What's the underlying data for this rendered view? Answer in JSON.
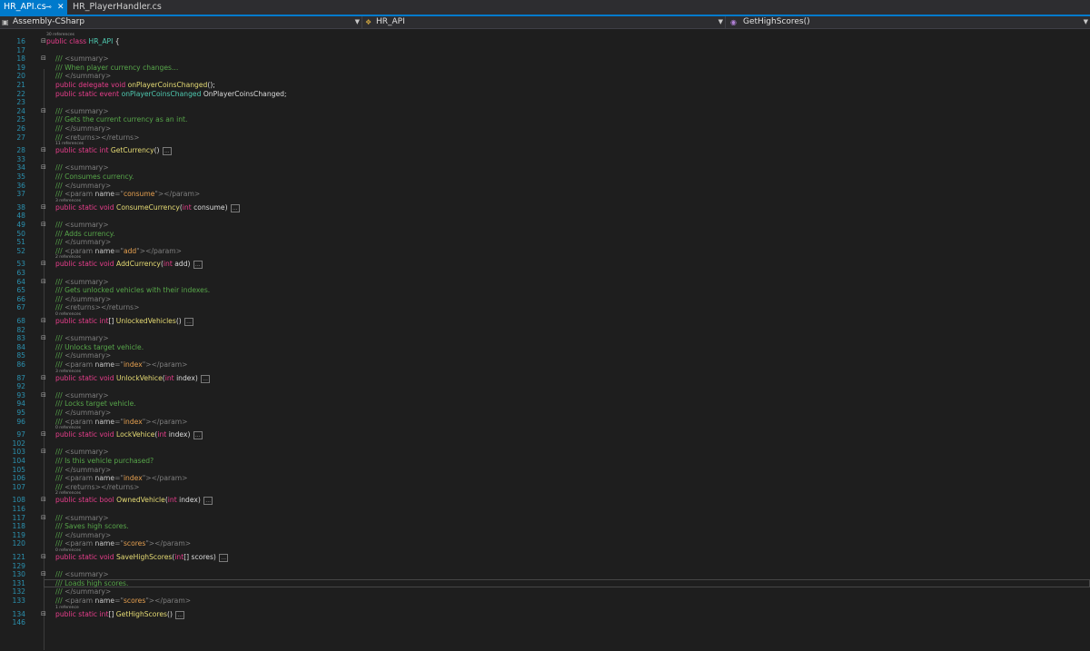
{
  "tabs": [
    {
      "label": "HR_API.cs",
      "active": true
    },
    {
      "label": "HR_PlayerHandler.cs",
      "active": false
    }
  ],
  "navigation": {
    "project": "Assembly-CSharp",
    "type": "HR_API",
    "member": "GetHighScores()"
  },
  "colors": {
    "accent": "#007acc",
    "background": "#1e1e1e",
    "keyword": "#e83e8c",
    "type": "#4ec9b0",
    "comment": "#57a64a",
    "line_number": "#2b91af"
  },
  "lines": [
    {
      "kind": "lens",
      "text": "30 references"
    },
    {
      "n": "16",
      "fold": true,
      "indent": 0,
      "tokens": [
        [
          "kw",
          "public class "
        ],
        [
          "cls",
          "HR_API"
        ],
        [
          "pl",
          " {"
        ]
      ]
    },
    {
      "n": "17",
      "indent": 1,
      "tokens": []
    },
    {
      "n": "18",
      "fold": true,
      "indent": 1,
      "tokens": [
        [
          "cm",
          "/// "
        ],
        [
          "xml",
          "<summary>"
        ]
      ]
    },
    {
      "n": "19",
      "indent": 1,
      "tokens": [
        [
          "cm",
          "/// When player currency changes..."
        ]
      ]
    },
    {
      "n": "20",
      "indent": 1,
      "tokens": [
        [
          "cm",
          "/// "
        ],
        [
          "xml",
          "</summary>"
        ]
      ]
    },
    {
      "n": "21",
      "indent": 1,
      "tokens": [
        [
          "kw",
          "public delegate void "
        ],
        [
          "fn",
          "onPlayerCoinsChanged"
        ],
        [
          "pl",
          "();"
        ]
      ]
    },
    {
      "n": "22",
      "indent": 1,
      "tokens": [
        [
          "kw",
          "public static event "
        ],
        [
          "cls",
          "onPlayerCoinsChanged "
        ],
        [
          "pl",
          "OnPlayerCoinsChanged;"
        ]
      ]
    },
    {
      "n": "23",
      "indent": 1,
      "tokens": []
    },
    {
      "n": "24",
      "fold": true,
      "indent": 1,
      "tokens": [
        [
          "cm",
          "/// "
        ],
        [
          "xml",
          "<summary>"
        ]
      ]
    },
    {
      "n": "25",
      "indent": 1,
      "tokens": [
        [
          "cm",
          "/// Gets the current currency as an int."
        ]
      ]
    },
    {
      "n": "26",
      "indent": 1,
      "tokens": [
        [
          "cm",
          "/// "
        ],
        [
          "xml",
          "</summary>"
        ]
      ]
    },
    {
      "n": "27",
      "indent": 1,
      "tokens": [
        [
          "cm",
          "/// "
        ],
        [
          "xml",
          "<returns></returns>"
        ]
      ]
    },
    {
      "kind": "lens",
      "indent": 1,
      "text": "11 references"
    },
    {
      "n": "28",
      "fold": true,
      "indent": 1,
      "tokens": [
        [
          "kw",
          "public static int "
        ],
        [
          "fn",
          "GetCurrency"
        ],
        [
          "pl",
          "() "
        ]
      ],
      "collapsed": "..."
    },
    {
      "n": "33",
      "indent": 1,
      "tokens": []
    },
    {
      "n": "34",
      "fold": true,
      "indent": 1,
      "tokens": [
        [
          "cm",
          "/// "
        ],
        [
          "xml",
          "<summary>"
        ]
      ]
    },
    {
      "n": "35",
      "indent": 1,
      "tokens": [
        [
          "cm",
          "/// Consumes currency."
        ]
      ]
    },
    {
      "n": "36",
      "indent": 1,
      "tokens": [
        [
          "cm",
          "/// "
        ],
        [
          "xml",
          "</summary>"
        ]
      ]
    },
    {
      "n": "37",
      "indent": 1,
      "tokens": [
        [
          "cm",
          "/// "
        ],
        [
          "xml",
          "<param "
        ],
        [
          "attr",
          "name"
        ],
        [
          "xml",
          "=\""
        ],
        [
          "str",
          "consume"
        ],
        [
          "xml",
          "\"></param>"
        ]
      ]
    },
    {
      "kind": "lens",
      "indent": 1,
      "text": "3 references"
    },
    {
      "n": "38",
      "fold": true,
      "indent": 1,
      "tokens": [
        [
          "kw",
          "public static void "
        ],
        [
          "fn",
          "ConsumeCurrency"
        ],
        [
          "pl",
          "("
        ],
        [
          "kw",
          "int "
        ],
        [
          "pl",
          "consume) "
        ]
      ],
      "collapsed": "..."
    },
    {
      "n": "48",
      "indent": 1,
      "tokens": []
    },
    {
      "n": "49",
      "fold": true,
      "indent": 1,
      "tokens": [
        [
          "cm",
          "/// "
        ],
        [
          "xml",
          "<summary>"
        ]
      ]
    },
    {
      "n": "50",
      "indent": 1,
      "tokens": [
        [
          "cm",
          "/// Adds currency."
        ]
      ]
    },
    {
      "n": "51",
      "indent": 1,
      "tokens": [
        [
          "cm",
          "/// "
        ],
        [
          "xml",
          "</summary>"
        ]
      ]
    },
    {
      "n": "52",
      "indent": 1,
      "tokens": [
        [
          "cm",
          "/// "
        ],
        [
          "xml",
          "<param "
        ],
        [
          "attr",
          "name"
        ],
        [
          "xml",
          "=\""
        ],
        [
          "str",
          "add"
        ],
        [
          "xml",
          "\"></param>"
        ]
      ]
    },
    {
      "kind": "lens",
      "indent": 1,
      "text": "2 references"
    },
    {
      "n": "53",
      "fold": true,
      "indent": 1,
      "tokens": [
        [
          "kw",
          "public static void "
        ],
        [
          "fn",
          "AddCurrency"
        ],
        [
          "pl",
          "("
        ],
        [
          "kw",
          "int "
        ],
        [
          "pl",
          "add) "
        ]
      ],
      "collapsed": "..."
    },
    {
      "n": "63",
      "indent": 1,
      "tokens": []
    },
    {
      "n": "64",
      "fold": true,
      "indent": 1,
      "tokens": [
        [
          "cm",
          "/// "
        ],
        [
          "xml",
          "<summary>"
        ]
      ]
    },
    {
      "n": "65",
      "indent": 1,
      "tokens": [
        [
          "cm",
          "/// Gets unlocked vehicles with their indexes."
        ]
      ]
    },
    {
      "n": "66",
      "indent": 1,
      "tokens": [
        [
          "cm",
          "/// "
        ],
        [
          "xml",
          "</summary>"
        ]
      ]
    },
    {
      "n": "67",
      "indent": 1,
      "tokens": [
        [
          "cm",
          "/// "
        ],
        [
          "xml",
          "<returns></returns>"
        ]
      ]
    },
    {
      "kind": "lens",
      "indent": 1,
      "text": "0 references"
    },
    {
      "n": "68",
      "fold": true,
      "indent": 1,
      "tokens": [
        [
          "kw",
          "public static int"
        ],
        [
          "pl",
          "[] "
        ],
        [
          "fn",
          "UnlockedVehicles"
        ],
        [
          "pl",
          "() "
        ]
      ],
      "collapsed": "..."
    },
    {
      "n": "82",
      "indent": 1,
      "tokens": []
    },
    {
      "n": "83",
      "fold": true,
      "indent": 1,
      "tokens": [
        [
          "cm",
          "/// "
        ],
        [
          "xml",
          "<summary>"
        ]
      ]
    },
    {
      "n": "84",
      "indent": 1,
      "tokens": [
        [
          "cm",
          "/// Unlocks target vehicle."
        ]
      ]
    },
    {
      "n": "85",
      "indent": 1,
      "tokens": [
        [
          "cm",
          "/// "
        ],
        [
          "xml",
          "</summary>"
        ]
      ]
    },
    {
      "n": "86",
      "indent": 1,
      "tokens": [
        [
          "cm",
          "/// "
        ],
        [
          "xml",
          "<param "
        ],
        [
          "attr",
          "name"
        ],
        [
          "xml",
          "=\""
        ],
        [
          "str",
          "index"
        ],
        [
          "xml",
          "\"></param>"
        ]
      ]
    },
    {
      "kind": "lens",
      "indent": 1,
      "text": "3 references"
    },
    {
      "n": "87",
      "fold": true,
      "indent": 1,
      "tokens": [
        [
          "kw",
          "public static void "
        ],
        [
          "fn",
          "UnlockVehice"
        ],
        [
          "pl",
          "("
        ],
        [
          "kw",
          "int "
        ],
        [
          "pl",
          "index) "
        ]
      ],
      "collapsed": "..."
    },
    {
      "n": "92",
      "indent": 1,
      "tokens": []
    },
    {
      "n": "93",
      "fold": true,
      "indent": 1,
      "tokens": [
        [
          "cm",
          "/// "
        ],
        [
          "xml",
          "<summary>"
        ]
      ]
    },
    {
      "n": "94",
      "indent": 1,
      "tokens": [
        [
          "cm",
          "/// Locks target vehicle."
        ]
      ]
    },
    {
      "n": "95",
      "indent": 1,
      "tokens": [
        [
          "cm",
          "/// "
        ],
        [
          "xml",
          "</summary>"
        ]
      ]
    },
    {
      "n": "96",
      "indent": 1,
      "tokens": [
        [
          "cm",
          "/// "
        ],
        [
          "xml",
          "<param "
        ],
        [
          "attr",
          "name"
        ],
        [
          "xml",
          "=\""
        ],
        [
          "str",
          "index"
        ],
        [
          "xml",
          "\"></param>"
        ]
      ]
    },
    {
      "kind": "lens",
      "indent": 1,
      "text": "0 references"
    },
    {
      "n": "97",
      "fold": true,
      "indent": 1,
      "tokens": [
        [
          "kw",
          "public static void "
        ],
        [
          "fn",
          "LockVehice"
        ],
        [
          "pl",
          "("
        ],
        [
          "kw",
          "int "
        ],
        [
          "pl",
          "index) "
        ]
      ],
      "collapsed": "..."
    },
    {
      "n": "102",
      "indent": 1,
      "tokens": []
    },
    {
      "n": "103",
      "fold": true,
      "indent": 1,
      "tokens": [
        [
          "cm",
          "/// "
        ],
        [
          "xml",
          "<summary>"
        ]
      ]
    },
    {
      "n": "104",
      "indent": 1,
      "tokens": [
        [
          "cm",
          "/// Is this vehicle purchased?"
        ]
      ]
    },
    {
      "n": "105",
      "indent": 1,
      "tokens": [
        [
          "cm",
          "/// "
        ],
        [
          "xml",
          "</summary>"
        ]
      ]
    },
    {
      "n": "106",
      "indent": 1,
      "tokens": [
        [
          "cm",
          "/// "
        ],
        [
          "xml",
          "<param "
        ],
        [
          "attr",
          "name"
        ],
        [
          "xml",
          "=\""
        ],
        [
          "str",
          "index"
        ],
        [
          "xml",
          "\"></param>"
        ]
      ]
    },
    {
      "n": "107",
      "indent": 1,
      "tokens": [
        [
          "cm",
          "/// "
        ],
        [
          "xml",
          "<returns></returns>"
        ]
      ]
    },
    {
      "kind": "lens",
      "indent": 1,
      "text": "2 references"
    },
    {
      "n": "108",
      "fold": true,
      "indent": 1,
      "tokens": [
        [
          "kw",
          "public static bool "
        ],
        [
          "fn",
          "OwnedVehicle"
        ],
        [
          "pl",
          "("
        ],
        [
          "kw",
          "int "
        ],
        [
          "pl",
          "index) "
        ]
      ],
      "collapsed": "..."
    },
    {
      "n": "116",
      "indent": 1,
      "tokens": []
    },
    {
      "n": "117",
      "fold": true,
      "indent": 1,
      "tokens": [
        [
          "cm",
          "/// "
        ],
        [
          "xml",
          "<summary>"
        ]
      ]
    },
    {
      "n": "118",
      "indent": 1,
      "tokens": [
        [
          "cm",
          "/// Saves high scores."
        ]
      ]
    },
    {
      "n": "119",
      "indent": 1,
      "tokens": [
        [
          "cm",
          "/// "
        ],
        [
          "xml",
          "</summary>"
        ]
      ]
    },
    {
      "n": "120",
      "indent": 1,
      "tokens": [
        [
          "cm",
          "/// "
        ],
        [
          "xml",
          "<param "
        ],
        [
          "attr",
          "name"
        ],
        [
          "xml",
          "=\""
        ],
        [
          "str",
          "scores"
        ],
        [
          "xml",
          "\"></param>"
        ]
      ]
    },
    {
      "kind": "lens",
      "indent": 1,
      "text": "0 references"
    },
    {
      "n": "121",
      "fold": true,
      "indent": 1,
      "tokens": [
        [
          "kw",
          "public static void "
        ],
        [
          "fn",
          "SaveHighScores"
        ],
        [
          "pl",
          "("
        ],
        [
          "kw",
          "int"
        ],
        [
          "pl",
          "[] scores) "
        ]
      ],
      "collapsed": "..."
    },
    {
      "n": "129",
      "indent": 1,
      "tokens": []
    },
    {
      "n": "130",
      "fold": true,
      "indent": 1,
      "tokens": [
        [
          "cm",
          "/// "
        ],
        [
          "xml",
          "<summary>"
        ]
      ]
    },
    {
      "n": "131",
      "indent": 1,
      "highlight": true,
      "tokens": [
        [
          "cm",
          "/// Loads high scores."
        ]
      ]
    },
    {
      "n": "132",
      "indent": 1,
      "tokens": [
        [
          "cm",
          "/// "
        ],
        [
          "xml",
          "</summary>"
        ]
      ]
    },
    {
      "n": "133",
      "indent": 1,
      "tokens": [
        [
          "cm",
          "/// "
        ],
        [
          "xml",
          "<param "
        ],
        [
          "attr",
          "name"
        ],
        [
          "xml",
          "=\""
        ],
        [
          "str",
          "scores"
        ],
        [
          "xml",
          "\"></param>"
        ]
      ]
    },
    {
      "kind": "lens",
      "indent": 1,
      "text": "1 reference"
    },
    {
      "n": "134",
      "fold": true,
      "indent": 1,
      "tokens": [
        [
          "kw",
          "public static int"
        ],
        [
          "pl",
          "[] "
        ],
        [
          "fn",
          "GetHighScores"
        ],
        [
          "pl",
          "() "
        ]
      ],
      "collapsed": "..."
    },
    {
      "n": "146",
      "indent": 1,
      "tokens": []
    }
  ]
}
